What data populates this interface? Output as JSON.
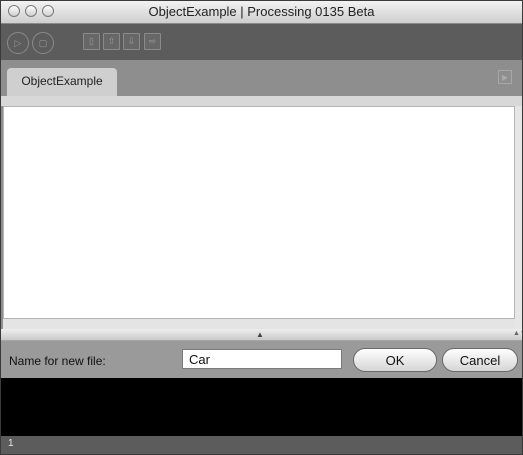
{
  "window": {
    "title": "ObjectExample | Processing 0135 Beta"
  },
  "toolbar": {
    "run_icon": "▷",
    "stop_icon": "▢",
    "new_icon": "▯",
    "open_icon": "⇧",
    "save_icon": "⇩",
    "export_icon": "⇨"
  },
  "tabs": [
    {
      "label": "ObjectExample"
    }
  ],
  "tab_menu_icon": "▶",
  "editor": {
    "content": ""
  },
  "new_file_prompt": {
    "label": "Name for new file:",
    "value": "Car",
    "ok_label": "OK",
    "cancel_label": "Cancel"
  },
  "splitter_icon": "▲",
  "scroll_icon": "▲▼",
  "footer": {
    "line_number": "1"
  },
  "colors": {
    "toolbar": "#5c5c5c",
    "tabbar": "#8e8e8e",
    "console": "#000000"
  }
}
